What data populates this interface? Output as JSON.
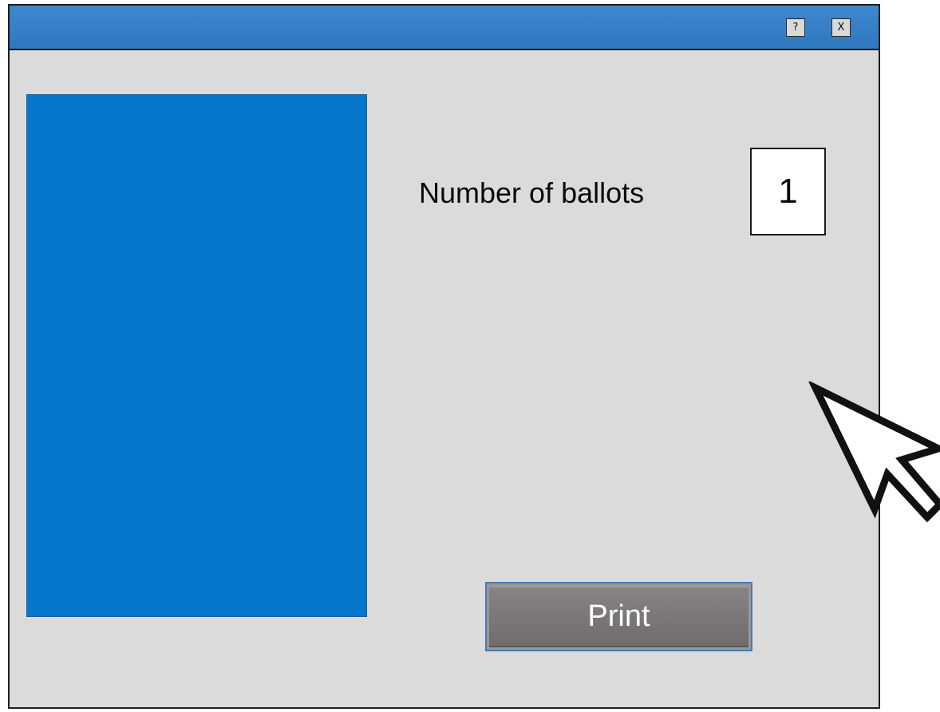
{
  "window": {
    "help_button_label": "?",
    "close_button_label": "X"
  },
  "form": {
    "ballots_label": "Number of ballots",
    "ballots_value": "1",
    "print_button_label": "Print"
  },
  "colors": {
    "titlebar": "#3a82c8",
    "window_bg": "#dcdbdc",
    "preview": "#0577cd",
    "print_button": "#7d7979"
  },
  "icons": {
    "cursor": "mouse-pointer-arrow-icon"
  }
}
